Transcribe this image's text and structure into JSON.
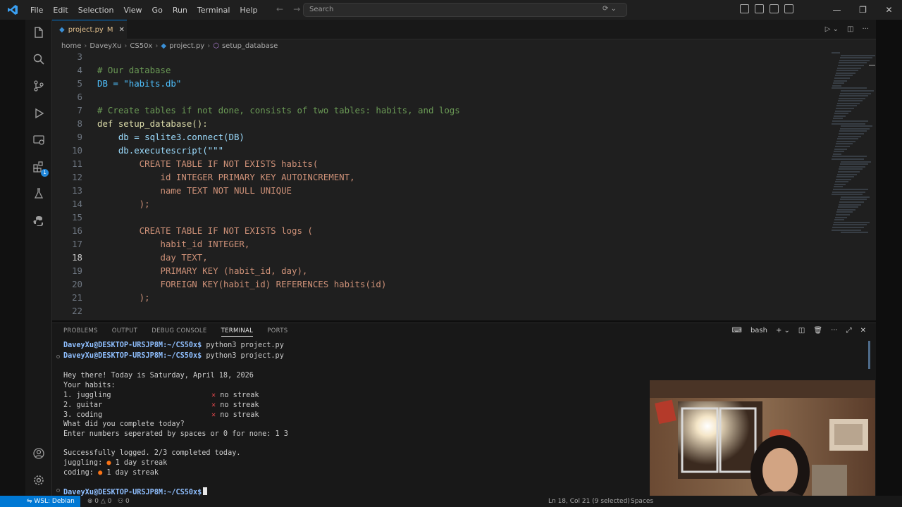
{
  "window": {
    "menu": [
      "File",
      "Edit",
      "Selection",
      "View",
      "Go",
      "Run",
      "Terminal",
      "Help"
    ],
    "search_placeholder": "Search"
  },
  "tab": {
    "filename": "project.py",
    "modified_marker": "M"
  },
  "breadcrumb": [
    "home",
    "DaveyXu",
    "CS50x",
    "project.py",
    "setup_database"
  ],
  "editor": {
    "current_line": 18,
    "lines": [
      {
        "n": "3",
        "text": ""
      },
      {
        "n": "4",
        "text": "# Our database"
      },
      {
        "n": "5",
        "text": "DB = \"habits.db\""
      },
      {
        "n": "6",
        "text": ""
      },
      {
        "n": "7",
        "text": "# Create tables if not done, consists of two tables: habits, and logs"
      },
      {
        "n": "8",
        "text": "def setup_database():"
      },
      {
        "n": "9",
        "text": "    db = sqlite3.connect(DB)"
      },
      {
        "n": "10",
        "text": "    db.executescript(\"\"\""
      },
      {
        "n": "11",
        "text": "        CREATE TABLE IF NOT EXISTS habits("
      },
      {
        "n": "12",
        "text": "            id INTEGER PRIMARY KEY AUTOINCREMENT,"
      },
      {
        "n": "13",
        "text": "            name TEXT NOT NULL UNIQUE"
      },
      {
        "n": "14",
        "text": "        );"
      },
      {
        "n": "15",
        "text": ""
      },
      {
        "n": "16",
        "text": "        CREATE TABLE IF NOT EXISTS logs ("
      },
      {
        "n": "17",
        "text": "            habit_id INTEGER,"
      },
      {
        "n": "18",
        "text": "            day TEXT,"
      },
      {
        "n": "19",
        "text": "            PRIMARY KEY (habit_id, day),"
      },
      {
        "n": "20",
        "text": "            FOREIGN KEY(habit_id) REFERENCES habits(id)"
      },
      {
        "n": "21",
        "text": "        );"
      },
      {
        "n": "22",
        "text": ""
      }
    ]
  },
  "panel": {
    "tabs": [
      "PROBLEMS",
      "OUTPUT",
      "DEBUG CONSOLE",
      "TERMINAL",
      "PORTS"
    ],
    "active_tab": "TERMINAL",
    "shell": "bash",
    "prompt": "DaveyXu@DESKTOP-URSJP8M:~/CS50x$",
    "command": "python3 project.py",
    "output": {
      "greeting": "Hey there! Today is Saturday, April 18, 2026",
      "habits_header": "Your habits:",
      "habits": [
        {
          "label": "1. juggling",
          "status": "no streak"
        },
        {
          "label": "2. guitar",
          "status": "no streak"
        },
        {
          "label": "3. coding",
          "status": "no streak"
        }
      ],
      "question": "What did you complete today?",
      "input_prompt": "Enter numbers seperated by spaces or 0 for none: 1 3",
      "success": "Successfully logged. 2/3 completed today.",
      "streaks": [
        {
          "name": "juggling:",
          "streak": "1 day streak"
        },
        {
          "name": "coding:",
          "streak": "1 day streak"
        }
      ]
    }
  },
  "status": {
    "remote": "WSL: Debian",
    "errors": "0",
    "warnings": "0",
    "ports": "0",
    "cursor": "Ln 18, Col 21 (9 selected)",
    "spaces": "Spaces"
  }
}
